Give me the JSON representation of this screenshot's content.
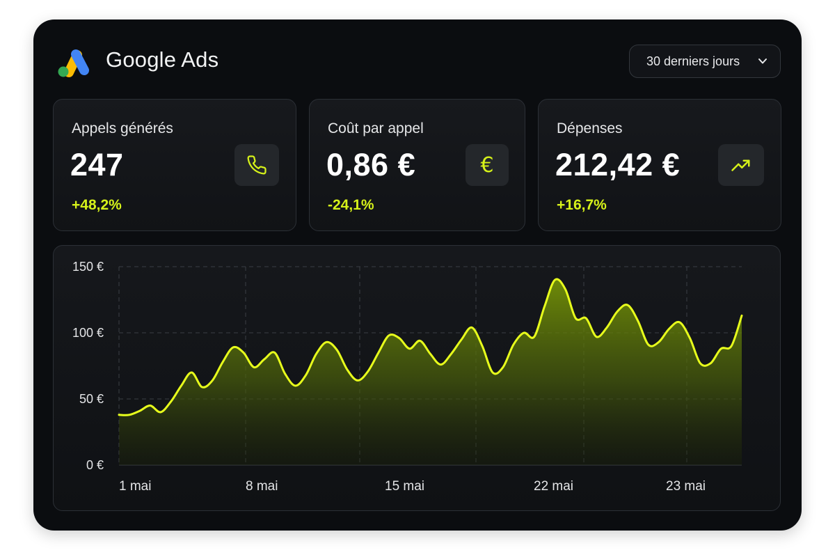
{
  "header": {
    "brand": "Google Ads",
    "date_range": "30 derniers jours"
  },
  "icons": {
    "logo": "google-ads-logo",
    "date_range": "chevron-down-icon",
    "calls": "phone-icon",
    "cost": "euro-icon",
    "spend": "trending-up-icon"
  },
  "colors": {
    "accent": "#d6f21a",
    "background": "#0b0d10",
    "logo_blue": "#4285f4",
    "logo_yellow": "#fbbc04",
    "logo_green": "#34a853"
  },
  "stats": [
    {
      "label": "Appels générés",
      "value": "247",
      "delta": "+48,2%"
    },
    {
      "label": "Coût par appel",
      "value": "0,86 €",
      "delta": "-24,1%"
    },
    {
      "label": "Dépenses",
      "value": "212,42 €",
      "delta": "+16,7%"
    }
  ],
  "chart_data": {
    "type": "area",
    "title": "",
    "xlabel": "",
    "ylabel": "",
    "ylim": [
      0,
      150
    ],
    "y_ticks": [
      "0 €",
      "50 €",
      "100 €",
      "150 €"
    ],
    "x_ticks": [
      "1 mai",
      "8 mai",
      "15 mai",
      "22 mai",
      "23 mai"
    ],
    "grid": true,
    "series": [
      {
        "values": [
          38,
          38,
          41,
          45,
          40,
          48,
          60,
          70,
          59,
          64,
          78,
          89,
          85,
          74,
          80,
          85,
          69,
          60,
          68,
          84,
          93,
          87,
          72,
          64,
          71,
          85,
          98,
          96,
          88,
          94,
          84,
          76,
          84,
          95,
          104,
          90,
          70,
          74,
          91,
          100,
          97,
          120,
          140,
          133,
          111,
          111,
          97,
          104,
          116,
          121,
          109,
          91,
          93,
          103,
          108,
          96,
          77,
          77,
          88,
          90,
          113
        ]
      }
    ]
  }
}
